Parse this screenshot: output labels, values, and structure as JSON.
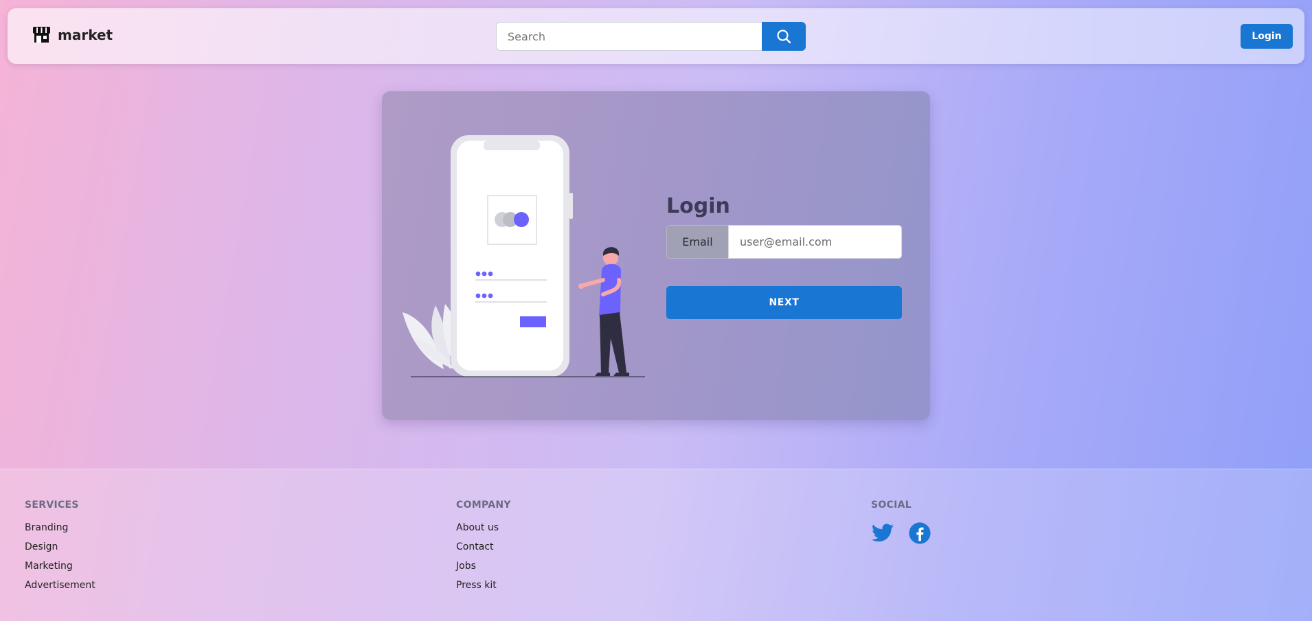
{
  "header": {
    "brand": "market",
    "search_placeholder": "Search",
    "login_label": "Login"
  },
  "card": {
    "title": "Login",
    "email_label": "Email",
    "email_placeholder": "user@email.com",
    "next_label": "NEXT"
  },
  "footer": {
    "services": {
      "title": "SERVICES",
      "links": [
        "Branding",
        "Design",
        "Marketing",
        "Advertisement"
      ]
    },
    "company": {
      "title": "COMPANY",
      "links": [
        "About us",
        "Contact",
        "Jobs",
        "Press kit"
      ]
    },
    "social": {
      "title": "SOCIAL",
      "icons": [
        "twitter-icon",
        "facebook-icon"
      ]
    }
  },
  "colors": {
    "primary": "#1976d2",
    "illustration_accent": "#6c63ff"
  }
}
